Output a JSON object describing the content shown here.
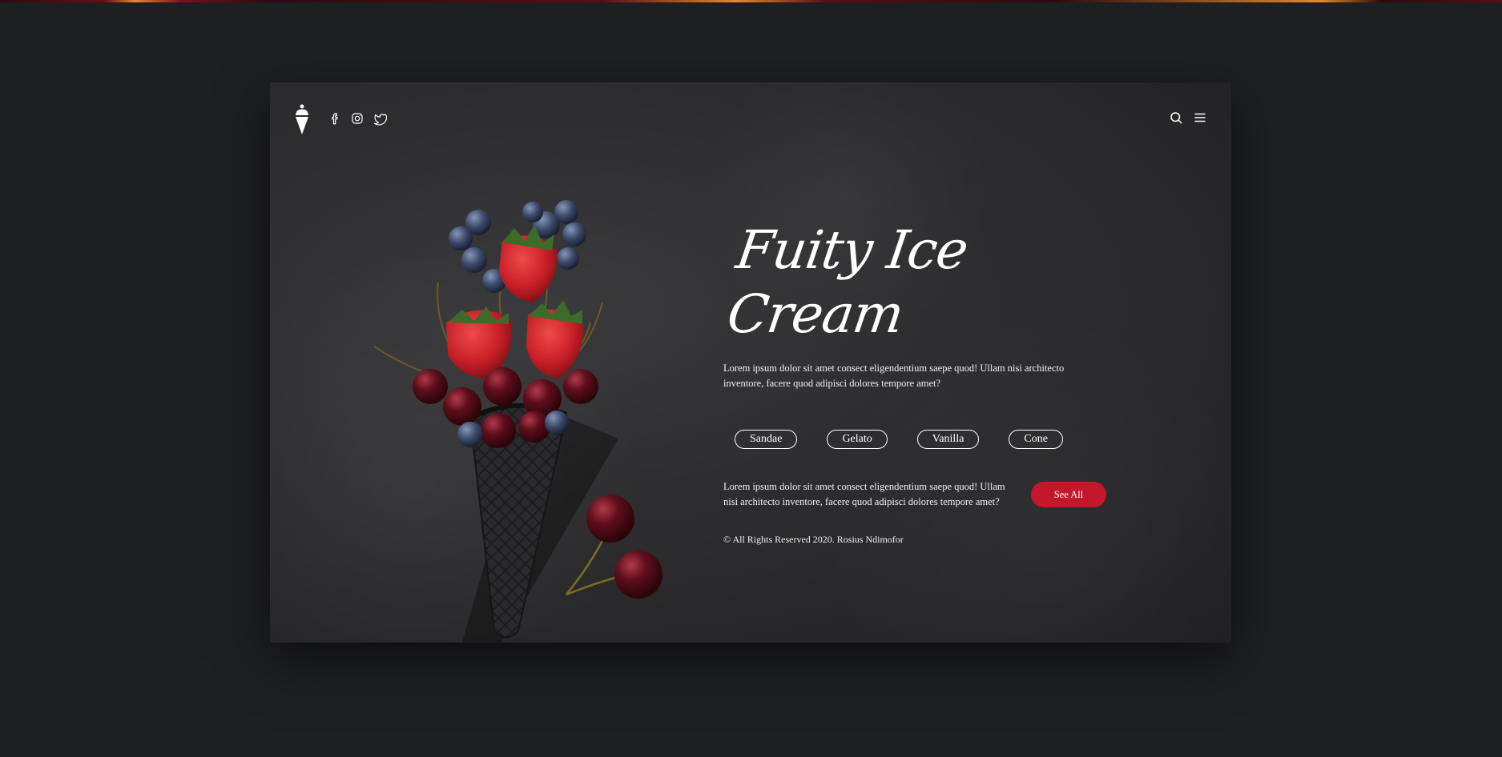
{
  "header": {
    "logo_icon": "ice-cream-cone-icon",
    "social_icons": [
      "facebook-icon",
      "instagram-icon",
      "twitter-icon"
    ],
    "right_icons": [
      "search-icon",
      "hamburger-menu-icon"
    ]
  },
  "hero": {
    "title": "Fuity Ice Cream",
    "description": "Lorem ipsum dolor sit amet consect eligendentium saepe quod! Ullam nisi architecto inventore, facere quod adipisci dolores tempore amet?",
    "tags": [
      "Sandae",
      "Gelato",
      "Vanilla",
      "Cone"
    ],
    "secondary_text": "Lorem ipsum dolor sit amet consect eligendentium saepe quod! Ullam nisi architecto inventore, facere quod adipisci dolores tempore amet?",
    "cta_label": "See All",
    "footer": "© All Rights Reserved 2020. Rosius Ndimofor"
  },
  "colors": {
    "page_bg": "#1e1f23",
    "card_bg": "#2e2e30",
    "accent": "#c4172c",
    "text": "#ffffff"
  }
}
